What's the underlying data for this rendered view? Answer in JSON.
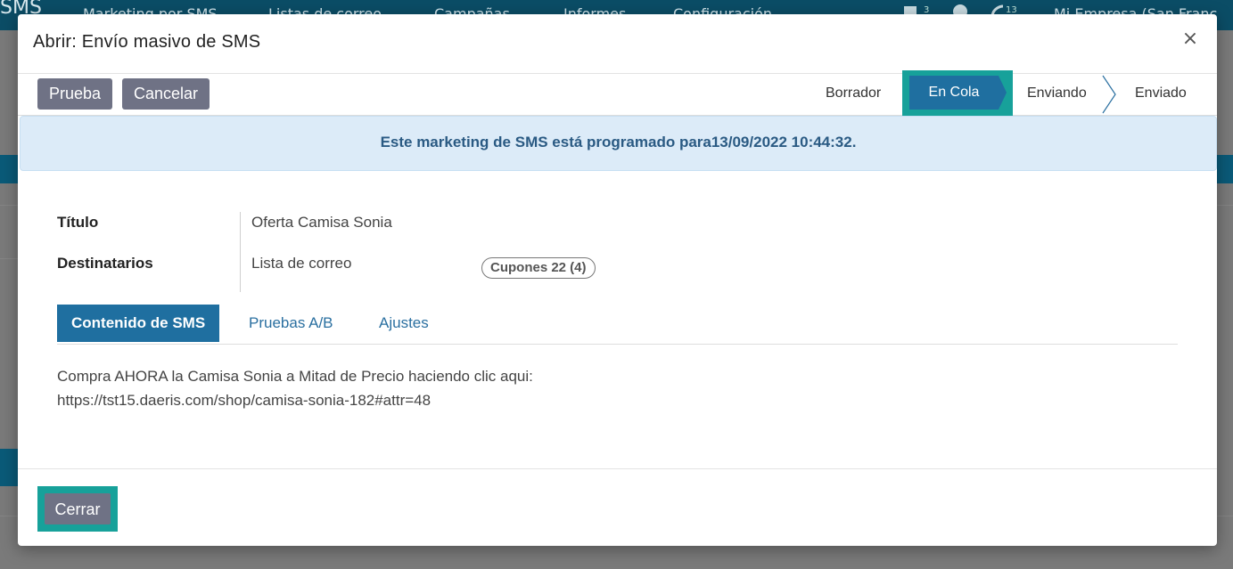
{
  "background": {
    "brand": "SMS",
    "menu": [
      "Marketing por SMS",
      "Listas de correo",
      "Campañas",
      "Informes",
      "Configuración"
    ],
    "chat_badge": "3",
    "activity_badge": "13",
    "company": "Mi Empresa (San Franc"
  },
  "modal": {
    "title": "Abrir: Envío masivo de SMS",
    "close_symbol": "×",
    "buttons": {
      "test": "Prueba",
      "cancel": "Cancelar"
    },
    "stages": [
      "Borrador",
      "En Cola",
      "Enviando",
      "Enviado"
    ],
    "active_stage": "En Cola",
    "alert": "Este marketing de SMS está programado para13/09/2022 10:44:32.",
    "fields": {
      "title_label": "Título",
      "title_value": "Oferta Camisa Sonia",
      "recipients_label": "Destinatarios",
      "recipients_value": "Lista de correo",
      "recipients_tag": "Cupones 22 (4)"
    },
    "tabs": [
      "Contenido de SMS",
      "Pruebas A/B",
      "Ajustes"
    ],
    "sms_content": [
      "Compra AHORA la Camisa Sonia a Mitad de Precio haciendo clic aqui:",
      "https://tst15.daeris.com/shop/camisa-sonia-182#attr=48"
    ],
    "footer_close": "Cerrar"
  },
  "colors": {
    "primary": "#1f6fa0",
    "highlight": "#17a19a",
    "secondary_button": "#6f7285",
    "alert_bg": "#dcebf8"
  }
}
